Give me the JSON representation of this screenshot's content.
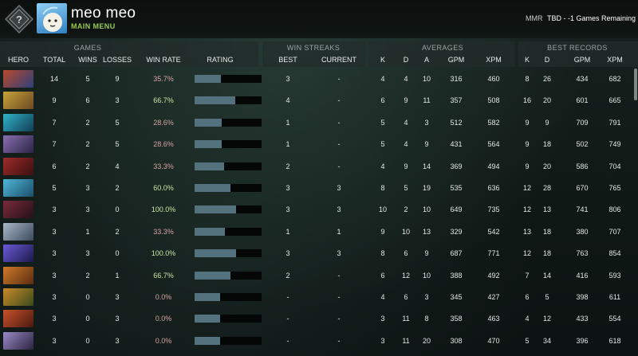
{
  "header": {
    "player_name": "meo meo",
    "main_menu": "MAIN MENU",
    "mmr_label": "MMR",
    "mmr_value": "TBD - -1 Games Remaining"
  },
  "groups": {
    "games": "GAMES",
    "win_streaks": "WIN STREAKS",
    "averages": "AVERAGES",
    "best_records": "BEST RECORDS"
  },
  "columns": {
    "hero": "HERO",
    "total": "TOTAL",
    "wins": "WINS",
    "losses": "LOSSES",
    "win_rate": "WIN RATE",
    "rating": "RATING",
    "streak_best": "BEST",
    "streak_current": "CURRENT",
    "k": "K",
    "d": "D",
    "a": "A",
    "gpm": "GPM",
    "xpm": "XPM",
    "best_k": "K",
    "best_d": "D",
    "best_gpm": "GPM",
    "best_xpm": "XPM"
  },
  "colors": {
    "win_rate_low": "#d6a5a5",
    "win_rate_high": "#c9e6a3",
    "rating_fill": "#54727d",
    "main_menu": "#9bc84a"
  },
  "rows": [
    {
      "total": "14",
      "wins": "5",
      "losses": "9",
      "win_rate": "35.7%",
      "rating": 0.39,
      "best": "3",
      "current": "-",
      "k": "4",
      "d": "4",
      "a": "10",
      "gpm": "316",
      "xpm": "460",
      "bk": "8",
      "bd": "26",
      "bgpm": "434",
      "bxpm": "682",
      "portrait": [
        "#b94a2c",
        "#2e3f7a"
      ]
    },
    {
      "total": "9",
      "wins": "6",
      "losses": "3",
      "win_rate": "66.7%",
      "rating": 0.61,
      "best": "4",
      "current": "-",
      "k": "6",
      "d": "9",
      "a": "11",
      "gpm": "357",
      "xpm": "508",
      "bk": "16",
      "bd": "20",
      "bgpm": "601",
      "bxpm": "665",
      "portrait": [
        "#c7a23a",
        "#6b4a22"
      ]
    },
    {
      "total": "7",
      "wins": "2",
      "losses": "5",
      "win_rate": "28.6%",
      "rating": 0.4,
      "best": "1",
      "current": "-",
      "k": "5",
      "d": "4",
      "a": "3",
      "gpm": "512",
      "xpm": "582",
      "bk": "9",
      "bd": "9",
      "bgpm": "709",
      "bxpm": "791",
      "portrait": [
        "#2fb2c8",
        "#123e55"
      ]
    },
    {
      "total": "7",
      "wins": "2",
      "losses": "5",
      "win_rate": "28.6%",
      "rating": 0.4,
      "best": "1",
      "current": "-",
      "k": "5",
      "d": "4",
      "a": "9",
      "gpm": "431",
      "xpm": "564",
      "bk": "9",
      "bd": "18",
      "bgpm": "502",
      "bxpm": "749",
      "portrait": [
        "#8a6fb0",
        "#2b2447"
      ]
    },
    {
      "total": "6",
      "wins": "2",
      "losses": "4",
      "win_rate": "33.3%",
      "rating": 0.44,
      "best": "2",
      "current": "-",
      "k": "4",
      "d": "9",
      "a": "14",
      "gpm": "369",
      "xpm": "494",
      "bk": "9",
      "bd": "20",
      "bgpm": "586",
      "bxpm": "704",
      "portrait": [
        "#a02a2a",
        "#3a1010"
      ]
    },
    {
      "total": "5",
      "wins": "3",
      "losses": "2",
      "win_rate": "60.0%",
      "rating": 0.53,
      "best": "3",
      "current": "3",
      "k": "8",
      "d": "5",
      "a": "19",
      "gpm": "535",
      "xpm": "636",
      "bk": "12",
      "bd": "28",
      "bgpm": "670",
      "bxpm": "765",
      "portrait": [
        "#4fb6d8",
        "#1b4f6a"
      ]
    },
    {
      "total": "3",
      "wins": "3",
      "losses": "0",
      "win_rate": "100.0%",
      "rating": 0.62,
      "best": "3",
      "current": "3",
      "k": "10",
      "d": "2",
      "a": "10",
      "gpm": "649",
      "xpm": "735",
      "bk": "12",
      "bd": "13",
      "bgpm": "741",
      "bxpm": "806",
      "portrait": [
        "#7a2a3a",
        "#241018"
      ]
    },
    {
      "total": "3",
      "wins": "1",
      "losses": "2",
      "win_rate": "33.3%",
      "rating": 0.45,
      "best": "1",
      "current": "1",
      "k": "9",
      "d": "10",
      "a": "13",
      "gpm": "329",
      "xpm": "542",
      "bk": "13",
      "bd": "18",
      "bgpm": "380",
      "bxpm": "707",
      "portrait": [
        "#aab8c8",
        "#3b4a5e"
      ]
    },
    {
      "total": "3",
      "wins": "3",
      "losses": "0",
      "win_rate": "100.0%",
      "rating": 0.62,
      "best": "3",
      "current": "3",
      "k": "8",
      "d": "6",
      "a": "9",
      "gpm": "687",
      "xpm": "771",
      "bk": "12",
      "bd": "18",
      "bgpm": "763",
      "bxpm": "854",
      "portrait": [
        "#6a5ad8",
        "#1c1a4a"
      ]
    },
    {
      "total": "3",
      "wins": "2",
      "losses": "1",
      "win_rate": "66.7%",
      "rating": 0.54,
      "best": "2",
      "current": "-",
      "k": "6",
      "d": "12",
      "a": "10",
      "gpm": "388",
      "xpm": "492",
      "bk": "7",
      "bd": "14",
      "bgpm": "416",
      "bxpm": "593",
      "portrait": [
        "#d07a2a",
        "#5a2c10"
      ]
    },
    {
      "total": "3",
      "wins": "0",
      "losses": "3",
      "win_rate": "0.0%",
      "rating": 0.38,
      "best": "-",
      "current": "-",
      "k": "4",
      "d": "6",
      "a": "3",
      "gpm": "345",
      "xpm": "427",
      "bk": "6",
      "bd": "5",
      "bgpm": "398",
      "bxpm": "611",
      "portrait": [
        "#c98a2a",
        "#3a4a1a"
      ]
    },
    {
      "total": "3",
      "wins": "0",
      "losses": "3",
      "win_rate": "0.0%",
      "rating": 0.38,
      "best": "-",
      "current": "-",
      "k": "3",
      "d": "11",
      "a": "8",
      "gpm": "358",
      "xpm": "463",
      "bk": "4",
      "bd": "12",
      "bgpm": "433",
      "bxpm": "554",
      "portrait": [
        "#c8502a",
        "#4a1a10"
      ]
    },
    {
      "total": "3",
      "wins": "0",
      "losses": "3",
      "win_rate": "0.0%",
      "rating": 0.38,
      "best": "-",
      "current": "-",
      "k": "3",
      "d": "11",
      "a": "20",
      "gpm": "308",
      "xpm": "470",
      "bk": "5",
      "bd": "34",
      "bgpm": "396",
      "bxpm": "618",
      "portrait": [
        "#9a8ac8",
        "#2a2440"
      ]
    }
  ]
}
